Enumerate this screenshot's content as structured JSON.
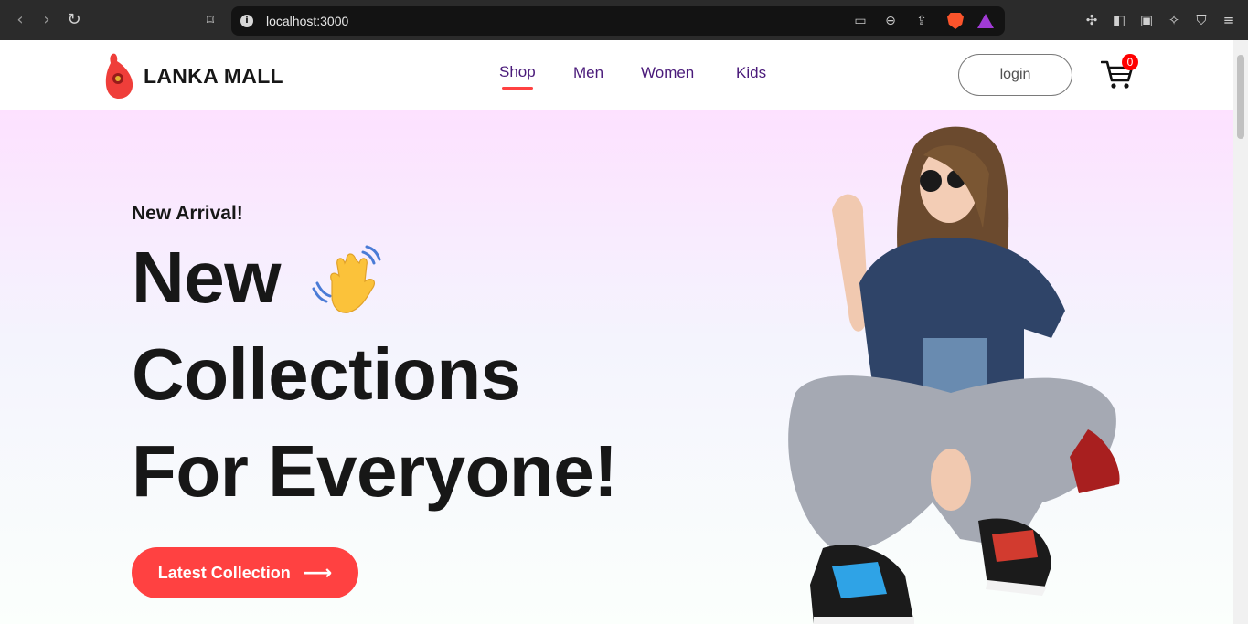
{
  "browser": {
    "url": "localhost:3000"
  },
  "brand": {
    "name": "LANKA MALL",
    "logo_color": "#ef3e3a"
  },
  "nav": {
    "items": [
      {
        "label": "Shop",
        "active": true
      },
      {
        "label": "Men"
      },
      {
        "label": "Women"
      },
      {
        "label": "Kids"
      }
    ],
    "login_label": "login",
    "cart_count": "0"
  },
  "hero": {
    "label": "New Arrival!",
    "line1": "New",
    "line2": "Collections",
    "line3": "For Everyone!",
    "cta_label": "Latest Collection",
    "accent_color": "#ff4141"
  }
}
